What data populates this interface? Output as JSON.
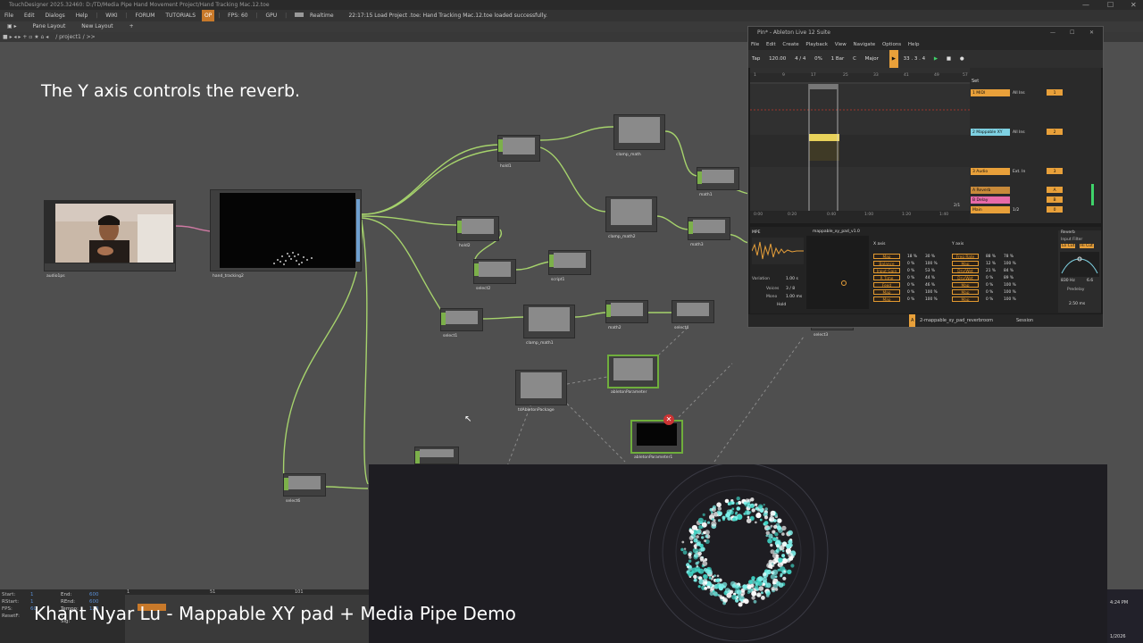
{
  "td": {
    "window_title": "TouchDesigner 2025.32460: D:/TD/Media Pipe Hand Movement Project/Hand Tracking Mac.12.toe",
    "menu": [
      "File",
      "Edit",
      "Dialogs",
      "Help"
    ],
    "links": [
      "WIKI",
      "FORUM",
      "TUTORIALS"
    ],
    "badge": "OP",
    "fps": "FPS: 60",
    "gpu": "GPU",
    "realtime": "Realtime",
    "status": "22:17:15 Load Project .toe: Hand Tracking Mac.12.toe loaded successfully.",
    "pane_layout": "Pane Layout",
    "new_layout": "New Layout",
    "path": "/ project1 / >>"
  },
  "overlay_title": "The Y axis controls the reverb.",
  "caption": "Khant Nyar Lu - Mappable XY pad + Media Pipe Demo",
  "nodes": {
    "n1": "audio1ps",
    "n2": "hand_tracking2",
    "n3": "hold1",
    "n4": "clamp_math",
    "n5": "math1",
    "n6": "hold2",
    "n7": "select2",
    "n8": "script1",
    "n9": "clamp_math2",
    "n10": "math3",
    "n11": "select1",
    "n12": "clamp_math1",
    "n13": "math2",
    "n14": "select4",
    "n15": "abletonParameter",
    "n16": "tdAbletonPackage",
    "n17": "abletonParameter1",
    "n18": "select6",
    "n19": "select3"
  },
  "timeline": {
    "start_k": "Start:",
    "start_v": "1",
    "end_k": "End:",
    "end_v": "600",
    "rstart_k": "RStart:",
    "rstart_v": "1",
    "rend_k": "REnd:",
    "rend_v": "600",
    "fps_k": "FPS:",
    "fps_v": "60",
    "tempo_k": "Tempo:",
    "tempo_v": "120",
    "resetf_k": "ResetF:",
    "tsig_k": "T Sig:",
    "ticks": [
      "1",
      "51",
      "101"
    ]
  },
  "clock": {
    "time": "4:24 PM",
    "date": "1/2026"
  },
  "ableton": {
    "title": "Pin* - Ableton Live 12 Suite",
    "menu": [
      "File",
      "Edit",
      "Create",
      "Playback",
      "View",
      "Navigate",
      "Options",
      "Help"
    ],
    "tap": "Tap",
    "bpm": "120.00",
    "sig": "4 / 4",
    "cpu": "0%",
    "quant": "1 Bar",
    "key": "C",
    "scale": "Major",
    "pos": "33 . 3 . 4",
    "ruler": [
      "1",
      "9",
      "17",
      "25",
      "33",
      "41",
      "49",
      "57"
    ],
    "time_ruler": [
      "0:00",
      "0:20",
      "0:40",
      "1:00",
      "1:20",
      "1:40"
    ],
    "fraction": "2/1",
    "set": "Set",
    "tracks": [
      {
        "name": "1 MIDI",
        "r1": "All Ins",
        "r2": "1"
      },
      {
        "name": "2 Mappable XY",
        "r1": "All Ins",
        "r2": "2"
      },
      {
        "name": "3 Audio",
        "r1": "Ext. In",
        "r2": "3"
      },
      {
        "name": "A Reverb",
        "r1": "",
        "r2": "A"
      },
      {
        "name": "B Delay",
        "r1": "",
        "r2": "B"
      },
      {
        "name": "Main",
        "r1": "1/2",
        "r2": "0"
      }
    ],
    "device_name": "mappable_xy_pad_v1.0",
    "x_axis": "X axis",
    "y_axis": "Y axis",
    "x_rows": [
      {
        "label": "Map",
        "min": "18 %",
        "max": "30 %"
      },
      {
        "label": "Balance",
        "min": "0 %",
        "max": "100 %"
      },
      {
        "label": "Input Gain",
        "min": "0 %",
        "max": "53 %"
      },
      {
        "label": "R Time",
        "min": "0 %",
        "max": "44 %"
      },
      {
        "label": "Feed",
        "min": "0 %",
        "max": "46 %"
      },
      {
        "label": "Map",
        "min": "0 %",
        "max": "100 %"
      },
      {
        "label": "Map",
        "min": "0 %",
        "max": "100 %"
      }
    ],
    "y_rows": [
      {
        "label": "Freq Rate",
        "min": "88 %",
        "max": "78 %"
      },
      {
        "label": "Map",
        "min": "12 %",
        "max": "100 %"
      },
      {
        "label": "Dry/Wet",
        "min": "21 %",
        "max": "84 %"
      },
      {
        "label": "Dry/Wet",
        "min": "0 %",
        "max": "89 %"
      },
      {
        "label": "Map",
        "min": "0 %",
        "max": "100 %"
      },
      {
        "label": "Map",
        "min": "0 %",
        "max": "100 %"
      },
      {
        "label": "Map",
        "min": "0 %",
        "max": "100 %"
      }
    ],
    "left_panel": [
      "MPE",
      "Variation",
      "1.00 s",
      "Voices",
      "3 / 8",
      "Mono",
      "1.00 ms",
      "Hold"
    ],
    "reverb_title": "Reverb",
    "input_filter": "Input Filter",
    "lo_cut": "Lo Cut",
    "hi_cut": "Hi Cut",
    "freq_left": "830 Hz",
    "freq_right": "6.6",
    "predelay": "Predelay",
    "predelay_val": "2.50 ms",
    "status_text": "2-mappable_xy_pad_reverbroom",
    "status_right": "Session"
  },
  "colors": {
    "node_green": "#7cb04a",
    "wire": "#9fce6a",
    "pink_wire": "#d07aa4",
    "ableton_orange": "#e8a03a",
    "ableton_cyan": "#7ed1e2",
    "particles": "#7ff0ea"
  }
}
